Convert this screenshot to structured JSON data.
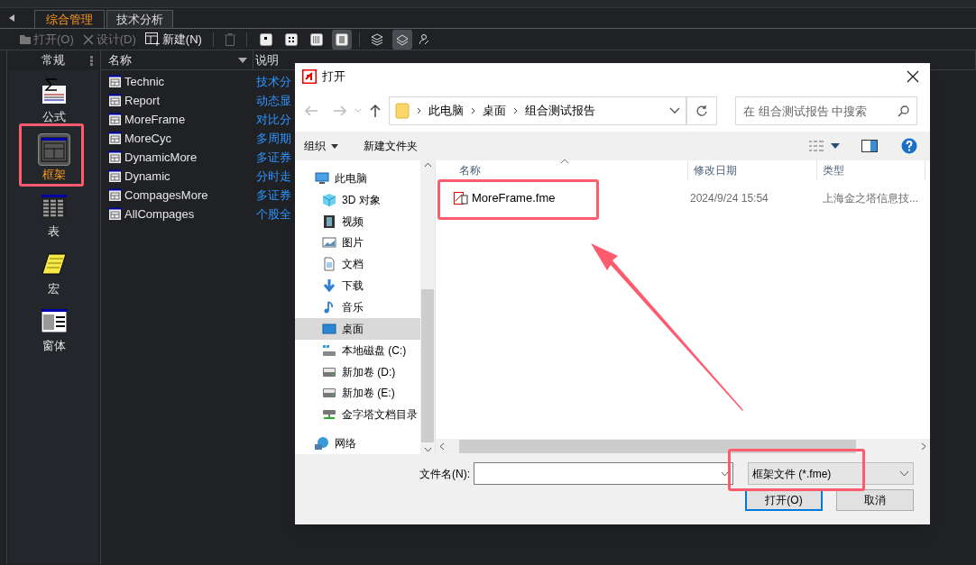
{
  "tabs": [
    {
      "label": "综合管理",
      "selected": true
    },
    {
      "label": "技术分析",
      "selected": false
    }
  ],
  "toolbar": {
    "buttons": [
      {
        "label": "打开(O)",
        "kind": "open",
        "disabled": true
      },
      {
        "label": "设计(D)",
        "kind": "design",
        "disabled": true
      },
      {
        "label": "新建(N)",
        "kind": "new",
        "disabled": false
      }
    ],
    "view_buttons": [
      {
        "kind": "one",
        "selected": false
      },
      {
        "kind": "four",
        "selected": false
      },
      {
        "kind": "grid",
        "selected": false
      },
      {
        "kind": "page",
        "selected": true
      }
    ],
    "layer_buttons": [
      {
        "kind": "layers",
        "selected": false
      },
      {
        "kind": "layer",
        "selected": true
      }
    ]
  },
  "sidebar": {
    "title": "常规",
    "items": [
      {
        "label": "公式",
        "kind": "formula",
        "selected": false
      },
      {
        "label": "框架",
        "kind": "frame",
        "selected": true
      },
      {
        "label": "表",
        "kind": "table",
        "selected": false
      },
      {
        "label": "宏",
        "kind": "macro",
        "selected": false
      },
      {
        "label": "窗体",
        "kind": "form",
        "selected": false
      }
    ]
  },
  "list": {
    "columns": [
      "名称",
      "说明"
    ],
    "rows": [
      {
        "name": "Technic",
        "description": "技术分"
      },
      {
        "name": "Report",
        "description": "动态显"
      },
      {
        "name": "MoreFrame",
        "description": "对比分"
      },
      {
        "name": "MoreCyc",
        "description": "多周期"
      },
      {
        "name": "DynamicMore",
        "description": "多证券"
      },
      {
        "name": "Dynamic",
        "description": "分时走"
      },
      {
        "name": "CompagesMore",
        "description": "多证券"
      },
      {
        "name": "AllCompages",
        "description": "个股全"
      }
    ]
  },
  "dialog": {
    "title": "打开",
    "breadcrumb": [
      "此电脑",
      "桌面",
      "组合测试报告"
    ],
    "search_placeholder": "在 组合测试报告 中搜索",
    "commands": [
      {
        "label": "组织",
        "kind": "menu"
      },
      {
        "label": "新建文件夹",
        "kind": "plain"
      }
    ],
    "nav": [
      {
        "label": "此电脑",
        "kind": "computer",
        "selected": false,
        "children": [
          {
            "label": "3D 对象",
            "kind": "cube",
            "selected": false
          },
          {
            "label": "视频",
            "kind": "video",
            "selected": false
          },
          {
            "label": "图片",
            "kind": "picture",
            "selected": false
          },
          {
            "label": "文档",
            "kind": "document",
            "selected": false
          },
          {
            "label": "下载",
            "kind": "download",
            "selected": false
          },
          {
            "label": "音乐",
            "kind": "music",
            "selected": false
          },
          {
            "label": "桌面",
            "kind": "desktop",
            "selected": true
          },
          {
            "label": "本地磁盘 (C:)",
            "kind": "system-drive",
            "selected": false
          },
          {
            "label": "新加卷 (D:)",
            "kind": "drive",
            "selected": false
          },
          {
            "label": "新加卷 (E:)",
            "kind": "drive",
            "selected": false
          },
          {
            "label": "金字塔文档目录",
            "kind": "network-drive",
            "selected": false
          }
        ]
      },
      {
        "label": "网络",
        "kind": "network",
        "selected": false
      }
    ],
    "columns": [
      "名称",
      "修改日期",
      "类型"
    ],
    "files": [
      {
        "name": "MoreFrame.fme",
        "modified": "2024/9/24 15:54",
        "type": "上海金之塔信息技..."
      }
    ],
    "filename_label": "文件名(N):",
    "filetype": "框架文件 (*.fme)",
    "buttons": [
      {
        "label": "打开(O)",
        "kind": "primary"
      },
      {
        "label": "取消",
        "kind": "secondary"
      }
    ]
  }
}
